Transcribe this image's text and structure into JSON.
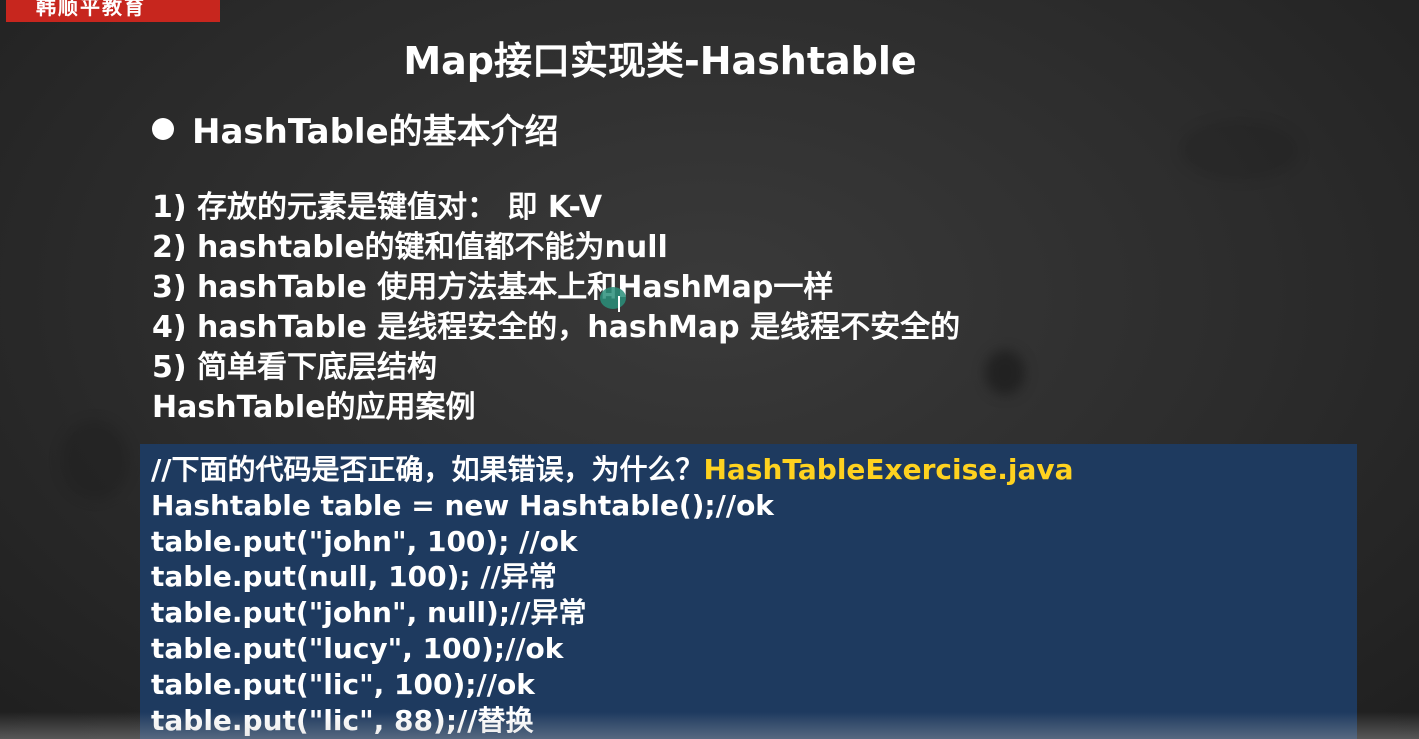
{
  "logo": {
    "text": "韩顺平教育"
  },
  "slide": {
    "title": "Map接口实现类-Hashtable",
    "heading": "HashTable的基本介绍",
    "points": [
      "1) 存放的元素是键值对： 即 K-V",
      "2) hashtable的键和值都不能为null",
      "3) hashTable 使用方法基本上和HashMap一样",
      "4) hashTable 是线程安全的，hashMap 是线程不安全的",
      "5) 简单看下底层结构",
      "HashTable的应用案例"
    ]
  },
  "code": {
    "comment": "//下面的代码是否正确，如果错误，为什么？",
    "filename": "HashTableExercise.java",
    "lines": [
      "Hashtable table = new Hashtable();//ok",
      "table.put(\"john\", 100); //ok",
      "table.put(null, 100); //异常",
      "table.put(\"john\", null);//异常",
      "table.put(\"lucy\", 100);//ok",
      "table.put(\"lic\", 100);//ok",
      "table.put(\"lic\", 88);//替换"
    ]
  },
  "colors": {
    "background": "#2b2b2b",
    "code_background": "#1e3a5f",
    "filename_highlight": "#ffd21f",
    "logo_red": "#c7261e"
  }
}
